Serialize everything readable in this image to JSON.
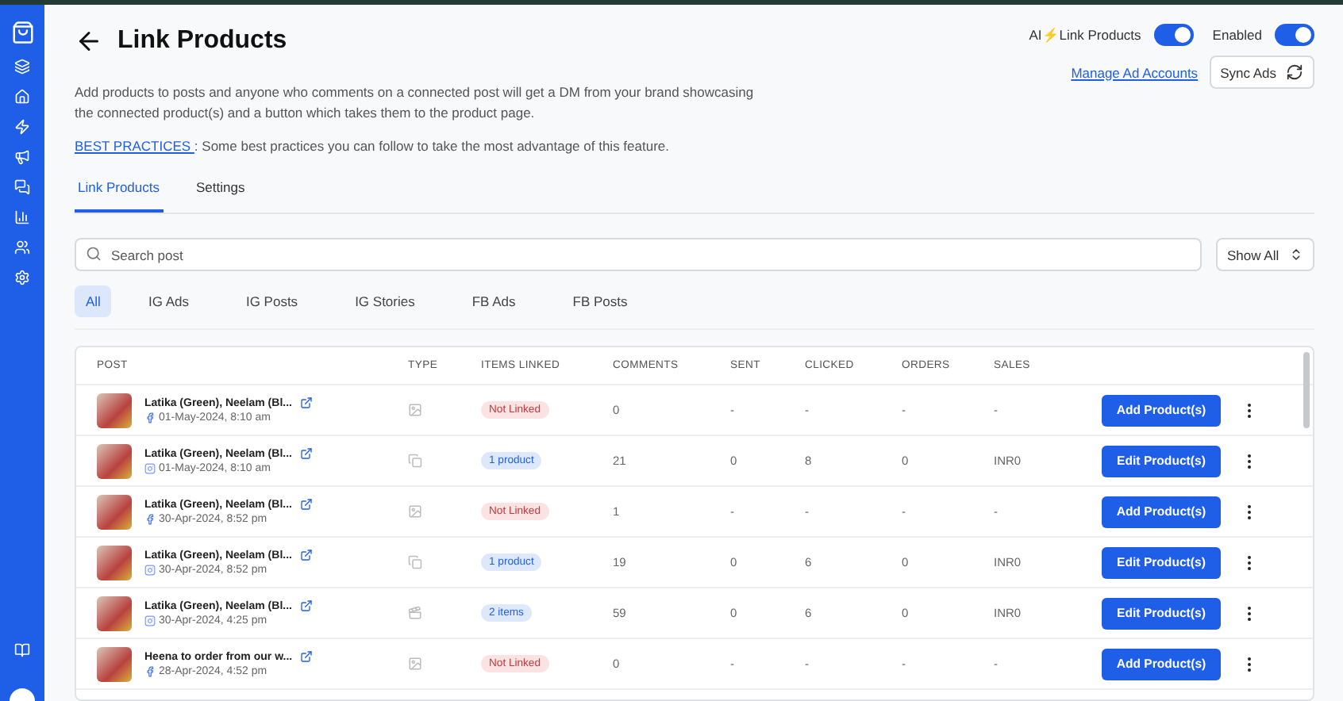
{
  "header": {
    "title": "Link Products",
    "toggles": [
      {
        "label": "AI",
        "emoji": "⚡",
        "label_rest": "Link Products",
        "on": true
      },
      {
        "label": "Enabled",
        "on": true
      }
    ],
    "manage_link": "Manage Ad Accounts",
    "sync_button": "Sync Ads"
  },
  "description": "Add products to posts and anyone who comments on a connected post will get a DM from your brand showcasing the connected product(s) and a button which takes them to the product page.",
  "best_practices": {
    "link": "BEST PRACTICES ",
    "text": ": Some best practices you can follow to take the most advantage of this feature."
  },
  "tabs": [
    {
      "label": "Link Products",
      "selected": true
    },
    {
      "label": "Settings",
      "selected": false
    }
  ],
  "search": {
    "placeholder": "Search post"
  },
  "show_select": "Show All",
  "filters": [
    {
      "label": "All",
      "selected": true
    },
    {
      "label": "IG Ads",
      "selected": false
    },
    {
      "label": "IG Posts",
      "selected": false
    },
    {
      "label": "IG Stories",
      "selected": false
    },
    {
      "label": "FB Ads",
      "selected": false
    },
    {
      "label": "FB Posts",
      "selected": false
    }
  ],
  "table": {
    "columns": [
      "POST",
      "TYPE",
      "ITEMS LINKED",
      "COMMENTS",
      "SENT",
      "CLICKED",
      "ORDERS",
      "SALES"
    ],
    "rows": [
      {
        "title": "Latika (Green), Neelam (Bl...",
        "date": "01-May-2024, 8:10 am",
        "network": {
          "kind": "facebook"
        },
        "type": {
          "kind": "image"
        },
        "items": {
          "kind": "not_linked",
          "label": "Not Linked"
        },
        "comments": "0",
        "sent": "-",
        "clicked": "-",
        "orders": "-",
        "sales": "-",
        "action": "Add Product(s)"
      },
      {
        "title": "Latika (Green), Neelam (Bl...",
        "date": "01-May-2024, 8:10 am",
        "network": {
          "kind": "instagram"
        },
        "type": {
          "kind": "carousel"
        },
        "items": {
          "kind": "linked",
          "label": "1 product"
        },
        "comments": "21",
        "sent": "0",
        "clicked": "8",
        "orders": "0",
        "sales": "INR0",
        "action": "Edit Product(s)"
      },
      {
        "title": "Latika (Green), Neelam (Bl...",
        "date": "30-Apr-2024, 8:52 pm",
        "network": {
          "kind": "facebook"
        },
        "type": {
          "kind": "image"
        },
        "items": {
          "kind": "not_linked",
          "label": "Not Linked"
        },
        "comments": "1",
        "sent": "-",
        "clicked": "-",
        "orders": "-",
        "sales": "-",
        "action": "Add Product(s)"
      },
      {
        "title": "Latika (Green), Neelam (Bl...",
        "date": "30-Apr-2024, 8:52 pm",
        "network": {
          "kind": "instagram"
        },
        "type": {
          "kind": "carousel"
        },
        "items": {
          "kind": "linked",
          "label": "1 product"
        },
        "comments": "19",
        "sent": "0",
        "clicked": "6",
        "orders": "0",
        "sales": "INR0",
        "action": "Edit Product(s)"
      },
      {
        "title": "Latika (Green), Neelam (Bl...",
        "date": "30-Apr-2024, 4:25 pm",
        "network": {
          "kind": "instagram"
        },
        "type": {
          "kind": "video"
        },
        "items": {
          "kind": "linked",
          "label": "2 items"
        },
        "comments": "59",
        "sent": "0",
        "clicked": "6",
        "orders": "0",
        "sales": "INR0",
        "action": "Edit Product(s)"
      },
      {
        "title": "Heena to order from our w...",
        "date": "28-Apr-2024, 4:52 pm",
        "network": {
          "kind": "facebook"
        },
        "type": {
          "kind": "image"
        },
        "items": {
          "kind": "not_linked",
          "label": "Not Linked"
        },
        "comments": "0",
        "sent": "-",
        "clicked": "-",
        "orders": "-",
        "sales": "-",
        "action": "Add Product(s)"
      }
    ]
  }
}
